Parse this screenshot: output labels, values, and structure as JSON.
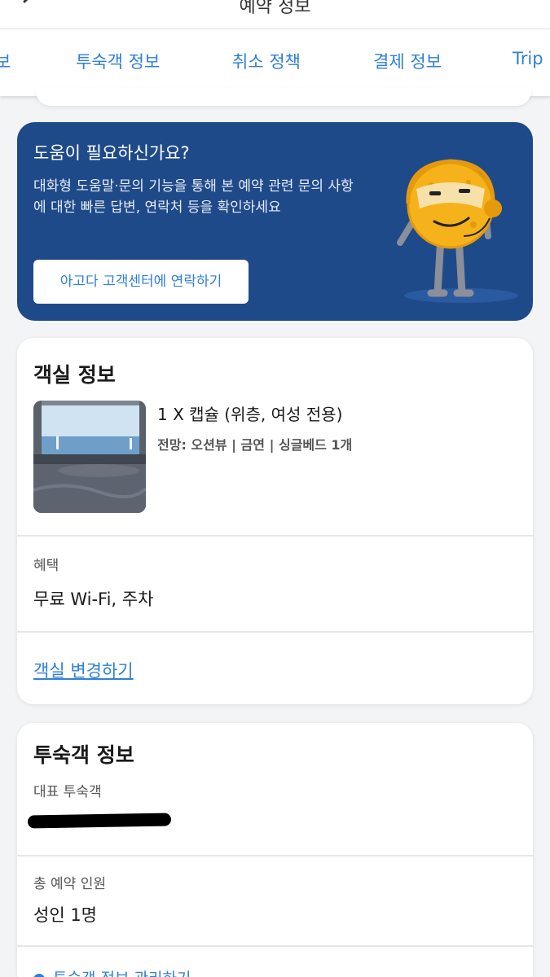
{
  "header": {
    "title": "예약 정보"
  },
  "tabs": [
    {
      "label": "보"
    },
    {
      "label": "투숙객 정보"
    },
    {
      "label": "취소 정책"
    },
    {
      "label": "결제 정보"
    },
    {
      "label": "Trip"
    }
  ],
  "help": {
    "title": "도움이 필요하신가요?",
    "description": "대화형 도움말·문의 기능을 통해 본 예약 관련 문의 사항에 대한 빠른 답변, 연락처 등을 확인하세요",
    "button_label": "아고다 고객센터에 연락하기"
  },
  "room": {
    "section_title": "객실 정보",
    "name": "1 X 캡슐 (위층, 여성 전용)",
    "meta": "전망: 오션뷰 | 금연 | 싱글베드 1개",
    "benefits_label": "혜택",
    "benefits_value": "무료 Wi-Fi, 주차",
    "change_link": "객실 변경하기"
  },
  "guest": {
    "section_title": "투숙객 정보",
    "lead_label": "대표 투숙객",
    "count_label": "총 예약 인원",
    "count_value": "성인 1명",
    "partial_row": "투숙객 정보 관리하기"
  },
  "colors": {
    "accent": "#2e7fd8",
    "help_bg": "#1f4a8a",
    "page_bg": "#f3f4f6"
  }
}
